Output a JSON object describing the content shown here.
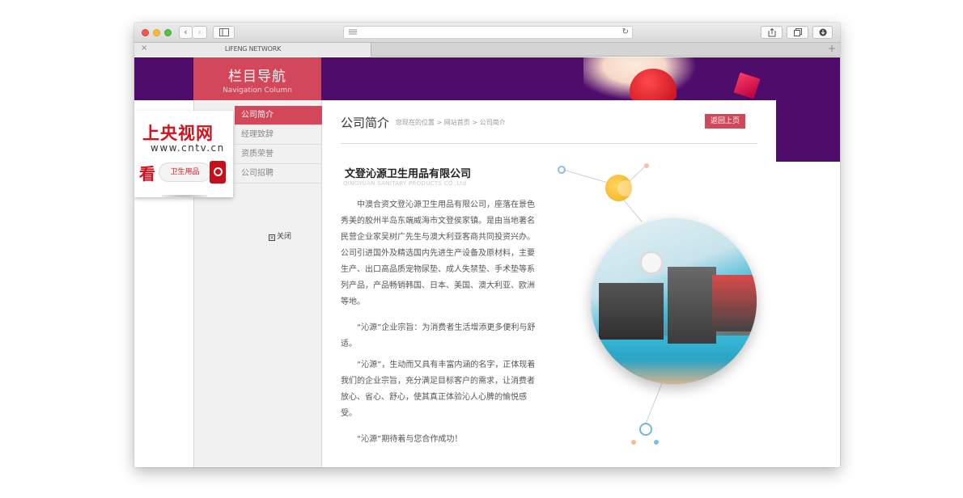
{
  "browser": {
    "tab_title": "LIFENG NETWORK",
    "tab_close": "×",
    "tab_add": "+",
    "back": "‹",
    "forward": "›",
    "reload": "↻"
  },
  "nav_header": {
    "title_cn": "栏目导航",
    "title_en": "Navigation Column"
  },
  "menu": [
    {
      "label": "公司简介",
      "active": true
    },
    {
      "label": "经理致辞",
      "active": false
    },
    {
      "label": "资质荣誉",
      "active": false
    },
    {
      "label": "公司招聘",
      "active": false
    }
  ],
  "ad": {
    "title": "上央视网",
    "url": "www.cntv.cn",
    "see": "看",
    "pill": "卫生用品",
    "close": "关闭",
    "close_box": "×"
  },
  "main": {
    "section_title": "公司简介",
    "breadcrumb": "您现在的位置 > 网站首页 > 公司简介",
    "back_button": "返回上页",
    "company_name": "文登沁源卫生用品有限公司",
    "company_name_en": "QINGYUAN SANITARY PRODUCTS CO.,Ltd",
    "paragraphs": [
      "中澳合资文登沁源卫生用品有限公司，座落在景色秀美的胶州半岛东端威海市文登侯家镇。是由当地著名民营企业家吴树广先生与澳大利亚客商共同投资兴办。公司引进国外及精选国内先进生产设备及原材料，主要生产、出口高品质宠物尿垫、成人失禁垫、手术垫等系列产品，产品畅销韩国、日本、美国、澳大利亚、欧洲等地。",
      "“沁源”企业宗旨：为消费者生活增添更多便利与舒适。",
      "“沁源”，生动而又具有丰富内涵的名字，正体现着我们的企业宗旨，充分满足目标客户的需求，让消费者放心、省心、舒心，使其真正体验沁人心脾的愉悦感受。",
      "“沁源”期待着与您合作成功！"
    ]
  },
  "colors": {
    "accent": "#d2485a",
    "banner": "#4e0d6a",
    "ad_red": "#d7101c"
  }
}
